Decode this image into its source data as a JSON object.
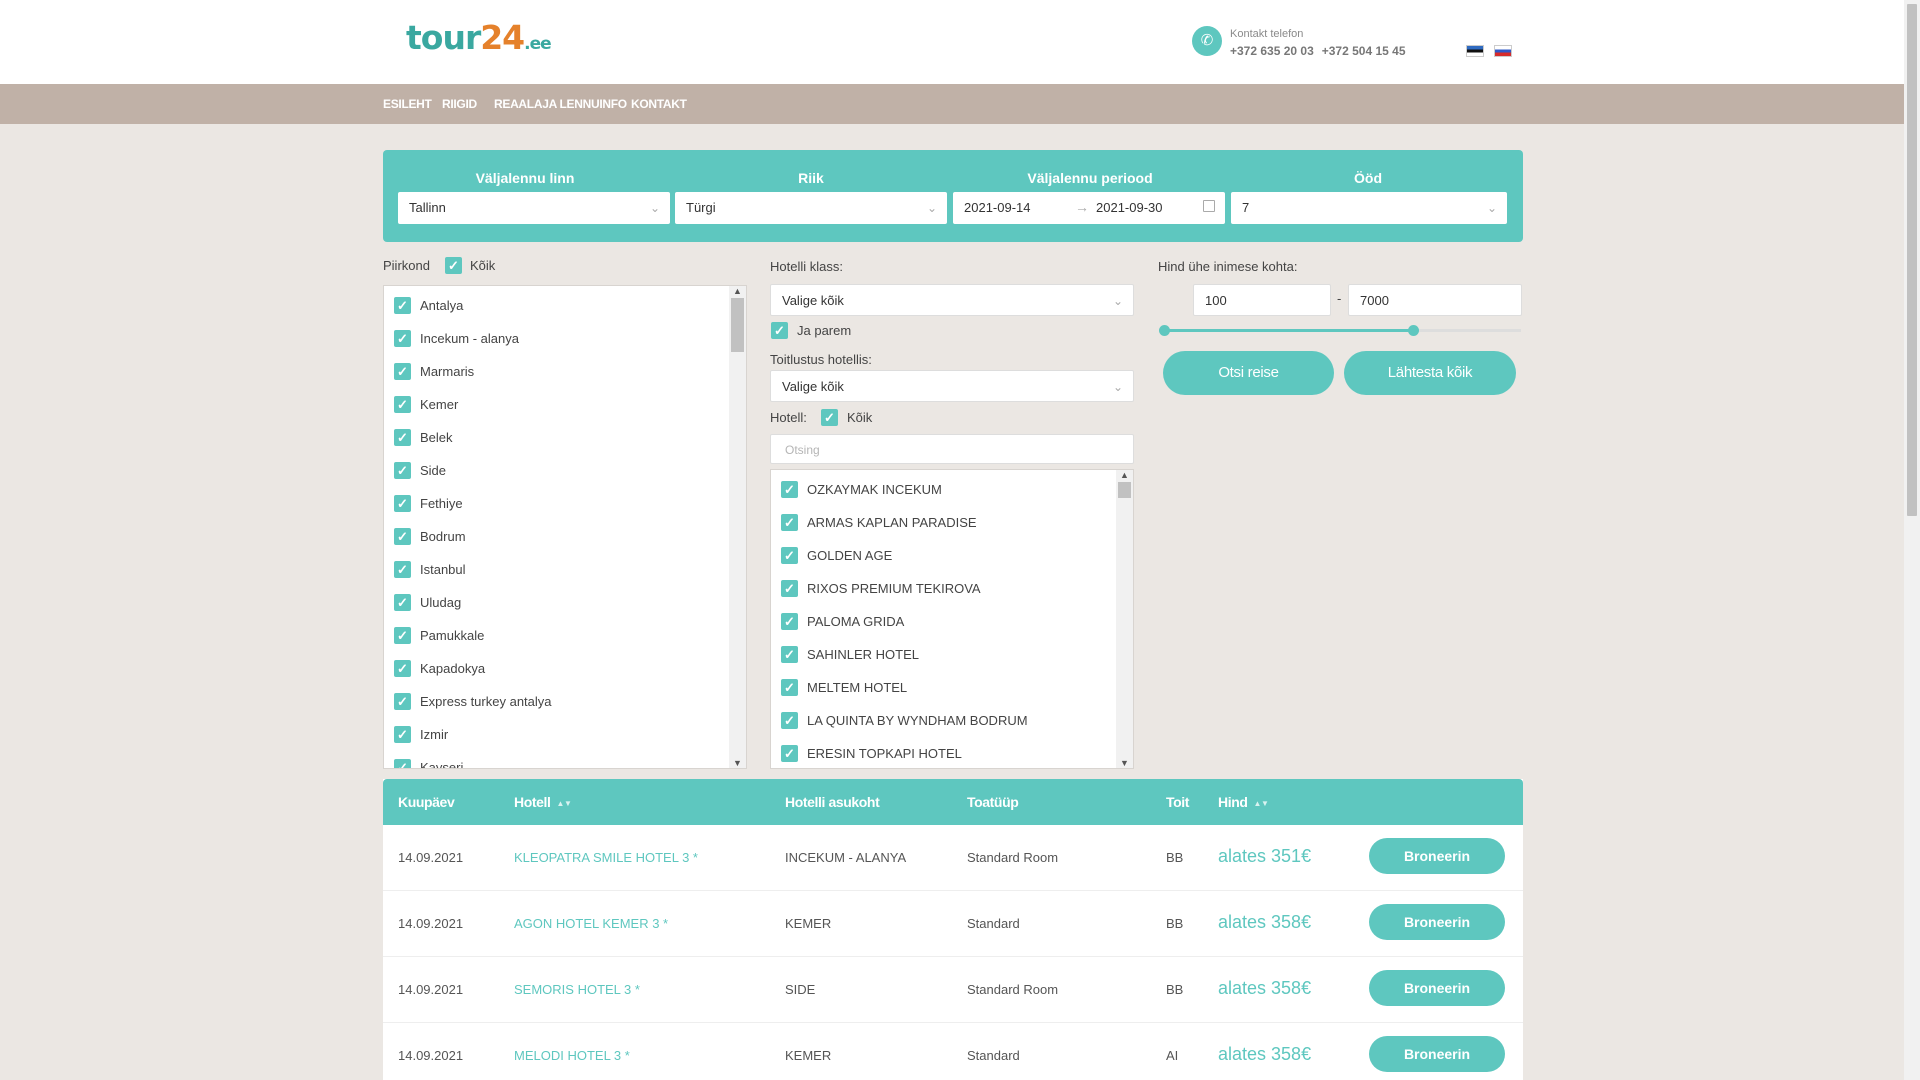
{
  "header": {
    "logo_main": "tour",
    "logo_num": "24",
    "logo_tld": ".ee",
    "contact_label": "Kontakt telefon",
    "phones": [
      "+372 635 20 03",
      "+372 504 15 45"
    ],
    "languages": [
      "et",
      "ru"
    ]
  },
  "nav": {
    "items": [
      "ESILEHT",
      "RIIGID",
      "REAALAJA LENNUINFO",
      "KONTAKT"
    ]
  },
  "search": {
    "departure_label": "Väljalennu linn",
    "departure_value": "Tallinn",
    "country_label": "Riik",
    "country_value": "Türgi",
    "period_label": "Väljalennu periood",
    "date_from": "2021-09-14",
    "date_to": "2021-09-30",
    "nights_label": "Ööd",
    "nights_value": "7"
  },
  "region": {
    "label": "Piirkond",
    "all_label": "Kõik",
    "items": [
      "Antalya",
      "Incekum - alanya",
      "Marmaris",
      "Kemer",
      "Belek",
      "Side",
      "Fethiye",
      "Bodrum",
      "Istanbul",
      "Uludag",
      "Pamukkale",
      "Kapadokya",
      "Express turkey antalya",
      "Izmir",
      "Kayseri"
    ]
  },
  "hotel_filters": {
    "class_label": "Hotelli klass:",
    "class_value": "Valige kõik",
    "better_label": "Ja parem",
    "meal_label": "Toitlustus hotellis:",
    "meal_value": "Valige kõik",
    "hotel_label": "Hotell:",
    "hotel_all_label": "Kõik",
    "search_placeholder": "Otsing",
    "hotels": [
      "OZKAYMAK INCEKUM",
      "ARMAS KAPLAN PARADISE",
      "GOLDEN AGE",
      "RIXOS PREMIUM TEKIROVA",
      "PALOMA GRIDA",
      "SAHINLER HOTEL",
      "MELTEM HOTEL",
      "LA QUINTA BY WYNDHAM BODRUM",
      "ERESIN TOPKAPI HOTEL"
    ]
  },
  "price": {
    "label": "Hind ühe inimese kohta:",
    "min": "100",
    "max": "7000",
    "separator": "-",
    "search_button": "Otsi reise",
    "reset_button": "Lähtesta kõik"
  },
  "results": {
    "headers": {
      "date": "Kuupäev",
      "hotel": "Hotell",
      "location": "Hotelli asukoht",
      "room": "Toatüüp",
      "meal": "Toit",
      "price": "Hind"
    },
    "rows": [
      {
        "date": "14.09.2021",
        "hotel": "KLEOPATRA SMILE HOTEL 3 *",
        "location": "INCEKUM - ALANYA",
        "room": "Standard Room",
        "meal": "BB",
        "price": "alates 351€",
        "action": "Broneerin"
      },
      {
        "date": "14.09.2021",
        "hotel": "AGON HOTEL KEMER 3 *",
        "location": "KEMER",
        "room": "Standard",
        "meal": "BB",
        "price": "alates 358€",
        "action": "Broneerin"
      },
      {
        "date": "14.09.2021",
        "hotel": "SEMORIS HOTEL 3 *",
        "location": "SIDE",
        "room": "Standard Room",
        "meal": "BB",
        "price": "alates 358€",
        "action": "Broneerin"
      },
      {
        "date": "14.09.2021",
        "hotel": "MELODI HOTEL 3 *",
        "location": "KEMER",
        "room": "Standard",
        "meal": "AI",
        "price": "alates 358€",
        "action": "Broneerin"
      }
    ]
  },
  "colors": {
    "accent": "#5ec7bf",
    "nav_bg": "#c0b1a7",
    "page_bg": "#ebe7e3",
    "logo_orange": "#e5812b"
  }
}
